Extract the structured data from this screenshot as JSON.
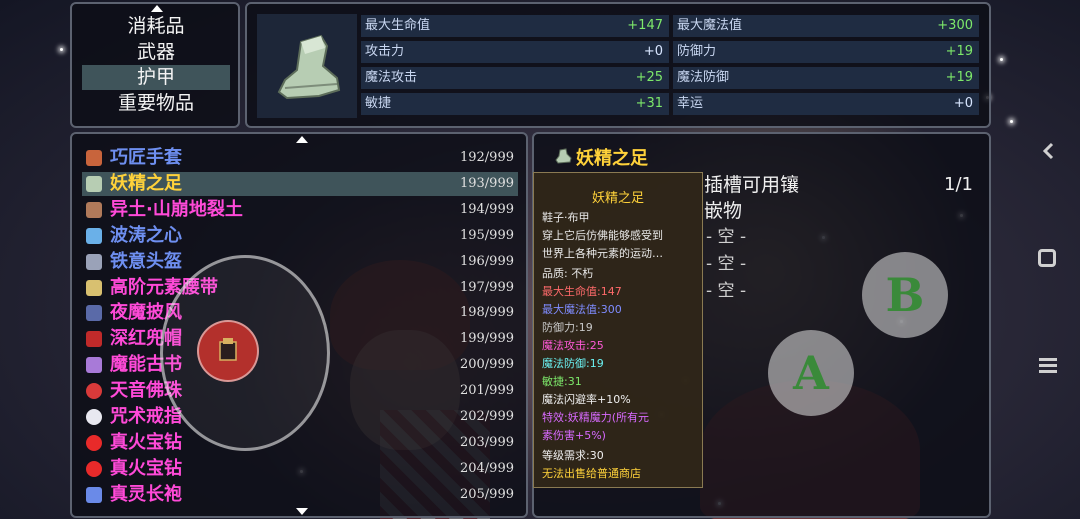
{
  "categories": {
    "items": [
      "消耗品",
      "武器",
      "护甲",
      "重要物品"
    ],
    "selected_index": 2
  },
  "item_icon": "boot-icon",
  "stats": {
    "left": [
      {
        "label": "最大生命值",
        "value": "+147"
      },
      {
        "label": "攻击力",
        "value": "+0"
      },
      {
        "label": "魔法攻击",
        "value": "+25"
      },
      {
        "label": "敏捷",
        "value": "+31"
      }
    ],
    "right": [
      {
        "label": "最大魔法值",
        "value": "+300"
      },
      {
        "label": "防御力",
        "value": "+19"
      },
      {
        "label": "魔法防御",
        "value": "+19"
      },
      {
        "label": "幸运",
        "value": "+0"
      }
    ]
  },
  "item_list": {
    "selected_index": 1,
    "rows": [
      {
        "name": "巧匠手套",
        "count": "192/999",
        "color": "#6e8ff0",
        "icon": "glove-icon"
      },
      {
        "name": "妖精之足",
        "count": "193/999",
        "color": "#ffd23a",
        "icon": "boot-icon"
      },
      {
        "name": "异土·山崩地裂土",
        "count": "194/999",
        "color": "#ff4ad8",
        "icon": "earth-icon"
      },
      {
        "name": "波涛之心",
        "count": "195/999",
        "color": "#6e8ff0",
        "icon": "wave-icon"
      },
      {
        "name": "铁意头盔",
        "count": "196/999",
        "color": "#6e8ff0",
        "icon": "helmet-icon"
      },
      {
        "name": "高阶元素腰带",
        "count": "197/999",
        "color": "#ff4ad8",
        "icon": "belt-icon"
      },
      {
        "name": "夜魔披风",
        "count": "198/999",
        "color": "#ff4ad8",
        "icon": "cape-icon"
      },
      {
        "name": "深红兜帽",
        "count": "199/999",
        "color": "#ff4ad8",
        "icon": "hood-icon"
      },
      {
        "name": "魔能古书",
        "count": "200/999",
        "color": "#ff4ad8",
        "icon": "book-icon"
      },
      {
        "name": "天音佛珠",
        "count": "201/999",
        "color": "#ff4ad8",
        "icon": "beads-icon"
      },
      {
        "name": "咒术戒指",
        "count": "202/999",
        "color": "#ff4ad8",
        "icon": "ring-icon"
      },
      {
        "name": "真火宝钻",
        "count": "203/999",
        "color": "#ff4ad8",
        "icon": "gem-icon"
      },
      {
        "name": "真火宝钻",
        "count": "204/999",
        "color": "#ff4ad8",
        "icon": "gem-icon"
      },
      {
        "name": "真灵长袍",
        "count": "205/999",
        "color": "#ff4ad8",
        "icon": "robe-icon"
      }
    ]
  },
  "detail": {
    "title": "妖精之足",
    "sockets_title": "插槽可用镶嵌物",
    "sockets_count": "1/1",
    "sockets": [
      "- 空 -",
      "- 空 -",
      "- 空 -"
    ]
  },
  "tooltip": {
    "title": "妖精之足",
    "lines": [
      {
        "text": "鞋子·布甲",
        "color": "#e8e8e8"
      },
      {
        "text": "穿上它后仿佛能够感受到",
        "color": "#e8e8e8"
      },
      {
        "text": "世界上各种元素的运动…",
        "color": "#e8e8e8"
      },
      {
        "text": "品质: 不朽",
        "color": "#e8e8e8"
      },
      {
        "text": "最大生命值:147",
        "color": "#ff6a6a"
      },
      {
        "text": "最大魔法值:300",
        "color": "#7f8cff"
      },
      {
        "text": "防御力:19",
        "color": "#c8c8c8"
      },
      {
        "text": "魔法攻击:25",
        "color": "#ff5ad8"
      },
      {
        "text": "魔法防御:19",
        "color": "#6af0f0"
      },
      {
        "text": "敏捷:31",
        "color": "#7de86a"
      },
      {
        "text": "魔法闪避率+10%",
        "color": "#f0f0f0"
      },
      {
        "text": "特效:妖精魔力(所有元",
        "color": "#d86aff"
      },
      {
        "text": "素伤害+5%)",
        "color": "#d86aff"
      },
      {
        "text": "等级需求:30",
        "color": "#f0f0f0"
      },
      {
        "text": "无法出售给普通商店",
        "color": "#ffd23a"
      }
    ]
  },
  "controls": {
    "btn_a": "A",
    "btn_b": "B"
  }
}
